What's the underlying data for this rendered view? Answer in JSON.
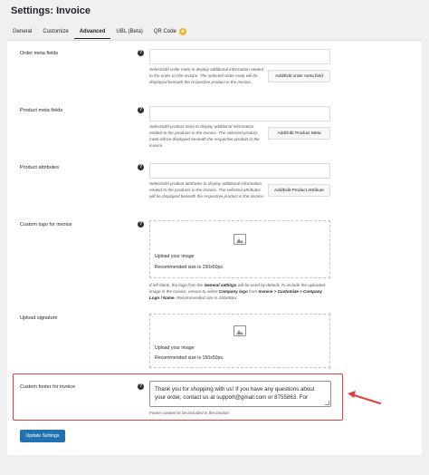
{
  "page": {
    "title": "Settings: Invoice"
  },
  "tabs": [
    {
      "label": "General"
    },
    {
      "label": "Customize"
    },
    {
      "label": "Advanced"
    },
    {
      "label": "UBL (Beta)"
    },
    {
      "label": "QR Code",
      "badge": "★"
    }
  ],
  "help_icon_text": "?",
  "order_meta": {
    "label": "Order meta fields",
    "desc": "Select/add order meta to display additional information related to the order on the invoice. The selected order meta will be displayed beneath the respective product in the invoice.",
    "button": "Add/Edit order meta field"
  },
  "product_meta": {
    "label": "Product meta fields",
    "desc": "Select/add product meta to display additional information related to the products in the invoice. The selected product meta will be displayed beneath the respective product in the invoice.",
    "button": "Add/Edit Product Meta"
  },
  "product_attributes": {
    "label": "Product attributes",
    "desc": "Select/add product attributes to display additional information related to the products in the invoice. The selected attributes will be displayed beneath the respective product in the invoice.",
    "button": "Add/Edit Product Attribute"
  },
  "custom_logo": {
    "label": "Custom logo for invoice",
    "upload_text": "Upload your image",
    "size_text": "Recommended size is 150x50px.",
    "note_prefix": "If left blank, the logo from the ",
    "note_bold1": "General settings",
    "note_mid": " will be used by default. To include the uploaded image in the invoice, ensure to select ",
    "note_bold2": "Company logo",
    "note_mid2": " from ",
    "note_bold3": "Invoice > Customize > Company Logo / Name",
    "note_suffix": ". Recommended size is 150x50px."
  },
  "signature": {
    "label": "Upload signature",
    "upload_text": "Upload your image",
    "size_text": "Recommended size is 150x50px."
  },
  "custom_footer": {
    "label": "Custom footer for invoice",
    "value": "Thank you for shopping with us! If you have any questions about your order, contact us at support@gmail.com or 8755863. For",
    "note": "Footer content to be included in the invoice."
  },
  "update_button": "Update Settings",
  "colors": {
    "accent": "#2271b1",
    "highlight": "#e04040"
  }
}
